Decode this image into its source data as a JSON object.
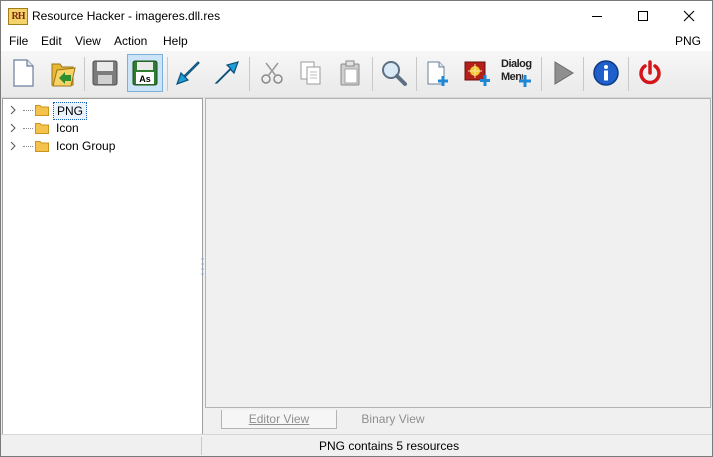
{
  "window": {
    "title": "Resource Hacker - imageres.dll.res",
    "app_icon_text": "RH"
  },
  "menu": {
    "items": [
      "File",
      "Edit",
      "View",
      "Action",
      "Help"
    ],
    "right_label": "PNG"
  },
  "toolbar": {
    "dialog_menu_label_line1": "Dialog",
    "dialog_menu_label_line2": "Menu",
    "save_as_label": "As"
  },
  "tree": {
    "items": [
      {
        "label": "PNG",
        "selected": true
      },
      {
        "label": "Icon",
        "selected": false
      },
      {
        "label": "Icon Group",
        "selected": false
      }
    ]
  },
  "tabs": {
    "editor": "Editor View",
    "binary": "Binary View"
  },
  "status": {
    "text": "PNG contains 5 resources"
  },
  "colors": {
    "accent": "#0078d7",
    "folder": "#f5c24c",
    "power": "#d4161b",
    "info": "#1f5fc9"
  }
}
